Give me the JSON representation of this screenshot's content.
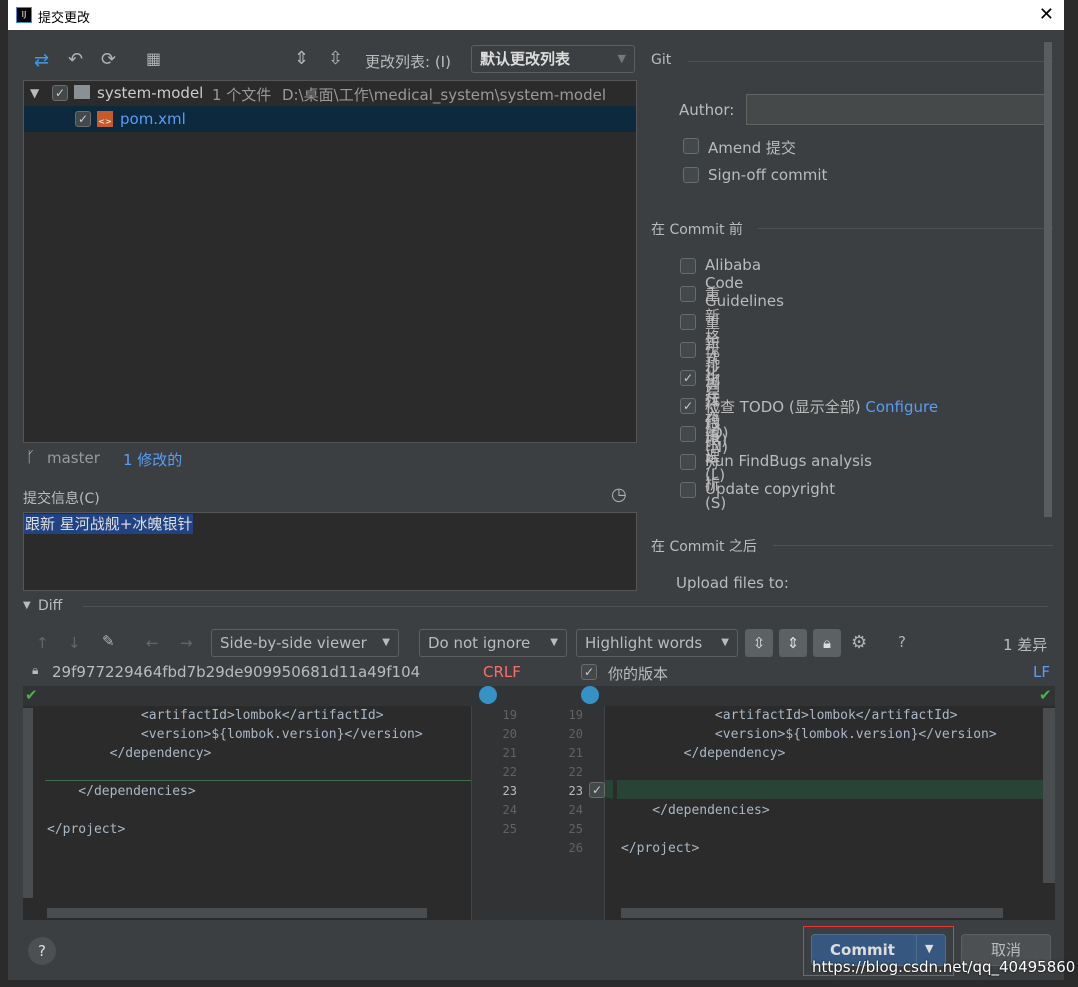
{
  "window": {
    "title": "提交更改",
    "app_icon": "IJ"
  },
  "toolbar": {
    "changelist_label": "更改列表: (I)",
    "changelist_value": "默认更改列表"
  },
  "tree": {
    "root": {
      "name": "system-model",
      "count": "1 个文件",
      "path": "D:\\桌面\\工作\\medical_system\\system-model",
      "checked": true
    },
    "file": {
      "name": "pom.xml",
      "checked": true
    }
  },
  "branch": {
    "name": "master",
    "changes": "1 修改的"
  },
  "commit_message": {
    "label": "提交信息(C)",
    "value": "跟新  星河战舰+冰魄银针"
  },
  "git": {
    "section": "Git",
    "author_label": "Author:",
    "author_value": "",
    "amend": "Amend 提交",
    "signoff": "Sign-off commit"
  },
  "before_commit": {
    "section": "在 Commit 前",
    "options": [
      {
        "label": "Alibaba Code Guidelines",
        "checked": false
      },
      {
        "label": "重新格式化代码(R)",
        "checked": false
      },
      {
        "label": "重新排列代码(N)",
        "checked": false
      },
      {
        "label": "优化导入(O)",
        "checked": false
      },
      {
        "label": "执行代码分析(S)",
        "checked": true
      },
      {
        "label": "检查 TODO (显示全部)",
        "checked": true,
        "link": "Configure"
      },
      {
        "label": "清理(L)",
        "checked": false
      },
      {
        "label": "Run FindBugs analysis",
        "checked": false
      },
      {
        "label": "Update copyright",
        "checked": false
      }
    ]
  },
  "after_commit": {
    "section": "在 Commit 之后",
    "upload": "Upload files to:"
  },
  "diff": {
    "label": "Diff",
    "viewer": "Side-by-side viewer",
    "ignore": "Do not ignore",
    "highlight": "Highlight words",
    "count": "1 差异",
    "left_rev": "29f977229464fbd7b29de909950681d11a49f104",
    "left_eol": "CRLF",
    "right_label": "你的版本",
    "right_eol": "LF",
    "left_lines": [
      {
        "n": "19",
        "code": "            <artifactId>lombok</artifactId>"
      },
      {
        "n": "20",
        "code": "            <version>${lombok.version}</version>"
      },
      {
        "n": "21",
        "code": "        </dependency>"
      },
      {
        "n": "22",
        "code": ""
      },
      {
        "n": "23",
        "code": "    </dependencies>"
      },
      {
        "n": "24",
        "code": ""
      },
      {
        "n": "25",
        "code": "</project>"
      }
    ],
    "right_lines": [
      {
        "n": "19",
        "code": "            <artifactId>lombok</artifactId>"
      },
      {
        "n": "20",
        "code": "            <version>${lombok.version}</version>"
      },
      {
        "n": "21",
        "code": "        </dependency>"
      },
      {
        "n": "22",
        "code": ""
      },
      {
        "n": "23",
        "code": ""
      },
      {
        "n": "24",
        "code": "    </dependencies>"
      },
      {
        "n": "25",
        "code": ""
      },
      {
        "n": "26",
        "code": "</project>"
      }
    ]
  },
  "buttons": {
    "commit": "Commit",
    "cancel": "取消",
    "help": "?"
  },
  "watermark": "https://blog.csdn.net/qq_40495860",
  "colors": {
    "accent": "#589df6",
    "added": "#294436",
    "selection": "#0d293e",
    "commit_btn": "#365880",
    "crlf": "#ff6b68"
  }
}
